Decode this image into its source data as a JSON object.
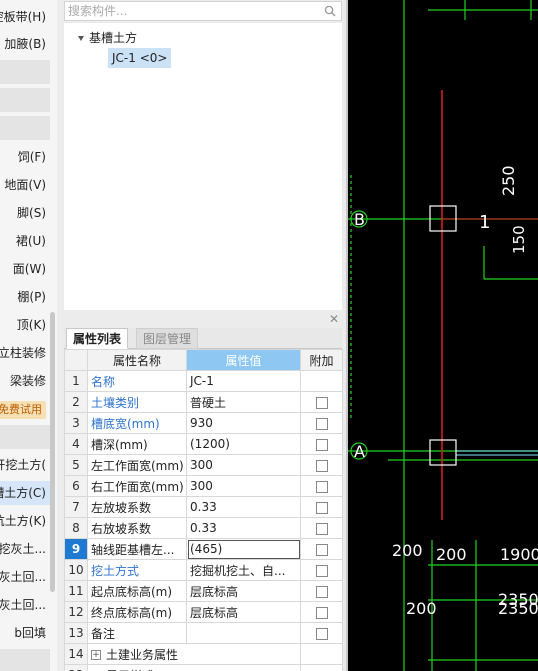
{
  "sidebar": {
    "items": [
      {
        "label": "腔板带(H)",
        "type": "normal"
      },
      {
        "label": "加腋(B)",
        "type": "normal"
      },
      {
        "label": "",
        "type": "sep"
      },
      {
        "label": "",
        "type": "sep"
      },
      {
        "label": "",
        "type": "sep"
      },
      {
        "label": "饲(F)",
        "type": "normal"
      },
      {
        "label": "地面(V)",
        "type": "normal"
      },
      {
        "label": "脚(S)",
        "type": "normal"
      },
      {
        "label": "裙(U)",
        "type": "normal"
      },
      {
        "label": "面(W)",
        "type": "normal"
      },
      {
        "label": "棚(P)",
        "type": "normal"
      },
      {
        "label": "顶(K)",
        "type": "normal"
      },
      {
        "label": "立柱装修",
        "type": "normal"
      },
      {
        "label": "梁装修",
        "type": "normal"
      },
      {
        "label": "免费试用",
        "type": "badge"
      },
      {
        "label": "",
        "type": "sep"
      },
      {
        "label": "开挖土方(",
        "type": "normal"
      },
      {
        "label": "槽土方(C)",
        "type": "sel"
      },
      {
        "label": "坑土方(K)",
        "type": "normal"
      },
      {
        "label": "开挖灰土...",
        "type": "normal"
      },
      {
        "label": "槽灰土回...",
        "type": "normal"
      },
      {
        "label": "坑灰土回...",
        "type": "normal"
      },
      {
        "label": "b回填",
        "type": "normal"
      },
      {
        "label": "",
        "type": "sep"
      }
    ]
  },
  "search": {
    "placeholder": "搜索构件..."
  },
  "tree": {
    "group": "基槽土方",
    "leaf": "JC-1 <0>"
  },
  "props": {
    "tabs": [
      "属性列表",
      "图层管理"
    ],
    "columns": {
      "name": "属性名称",
      "value": "属性值",
      "add": "附加"
    },
    "rows": [
      {
        "n": "1",
        "name": "名称",
        "value": "JC-1",
        "blue": true,
        "cb": false
      },
      {
        "n": "2",
        "name": "土壤类别",
        "value": "普硬土",
        "blue": true,
        "cb": true
      },
      {
        "n": "3",
        "name": "槽底宽(mm)",
        "value": "930",
        "blue": true,
        "cb": true
      },
      {
        "n": "4",
        "name": "槽深(mm)",
        "value": "(1200)",
        "blue": false,
        "cb": true
      },
      {
        "n": "5",
        "name": "左工作面宽(mm)",
        "value": "300",
        "blue": false,
        "cb": true
      },
      {
        "n": "6",
        "name": "右工作面宽(mm)",
        "value": "300",
        "blue": false,
        "cb": true
      },
      {
        "n": "7",
        "name": "左放坡系数",
        "value": "0.33",
        "blue": false,
        "cb": true
      },
      {
        "n": "8",
        "name": "右放坡系数",
        "value": "0.33",
        "blue": false,
        "cb": true
      },
      {
        "n": "9",
        "name": "轴线距基槽左...",
        "value": "(465)",
        "blue": false,
        "cb": true,
        "selected": true
      },
      {
        "n": "10",
        "name": "挖土方式",
        "value": "挖掘机挖土、自...",
        "blue": true,
        "cb": true
      },
      {
        "n": "11",
        "name": "起点底标高(m)",
        "value": "层底标高",
        "blue": false,
        "cb": true
      },
      {
        "n": "12",
        "name": "终点底标高(m)",
        "value": "层底标高",
        "blue": false,
        "cb": true
      },
      {
        "n": "13",
        "name": "备注",
        "value": "",
        "blue": false,
        "cb": true
      },
      {
        "n": "14",
        "name": "土建业务属性",
        "value": "",
        "blue": false,
        "cb": false,
        "expander": true
      },
      {
        "n": "22",
        "name": "显示样式",
        "value": "",
        "blue": false,
        "cb": false,
        "expander": true
      }
    ]
  },
  "canvas": {
    "labels": {
      "dim_250": "250",
      "dim_150": "150",
      "axis_b": "B",
      "axis_a": "A",
      "mark_1": "1",
      "dim_200a": "200",
      "dim_200b": "200",
      "dim_200c": "200",
      "dim_1900": "1900",
      "dim_2350": "2350",
      "dim_2350b": "2350"
    },
    "colors": {
      "axis_red": "#e02020",
      "line_green": "#21d021",
      "line_cyan": "#7fe6ff",
      "text_white": "#ffffff"
    }
  }
}
